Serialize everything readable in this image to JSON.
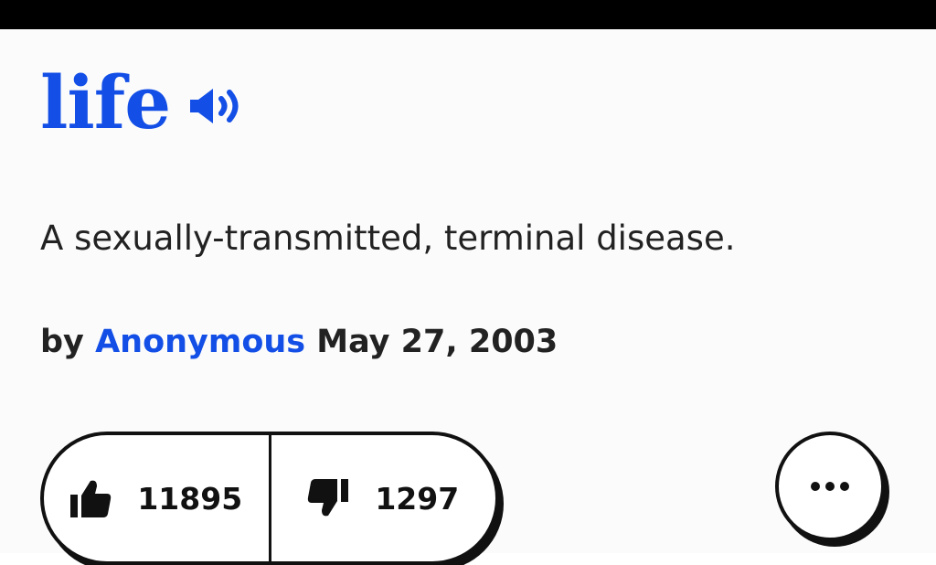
{
  "definition": {
    "word": "life",
    "meaning": "A sexually-transmitted, terminal disease.",
    "byline_prefix": "by",
    "author": "Anonymous",
    "date": "May 27, 2003"
  },
  "votes": {
    "up_count": "11895",
    "down_count": "1297"
  },
  "icons": {
    "pronounce": "speaker-icon",
    "upvote": "thumbs-up-icon",
    "downvote": "thumbs-down-icon",
    "more": "more-options-icon"
  },
  "colors": {
    "accent": "#134fe6",
    "text": "#222222",
    "outline": "#111111",
    "top_bar": "#000000"
  }
}
